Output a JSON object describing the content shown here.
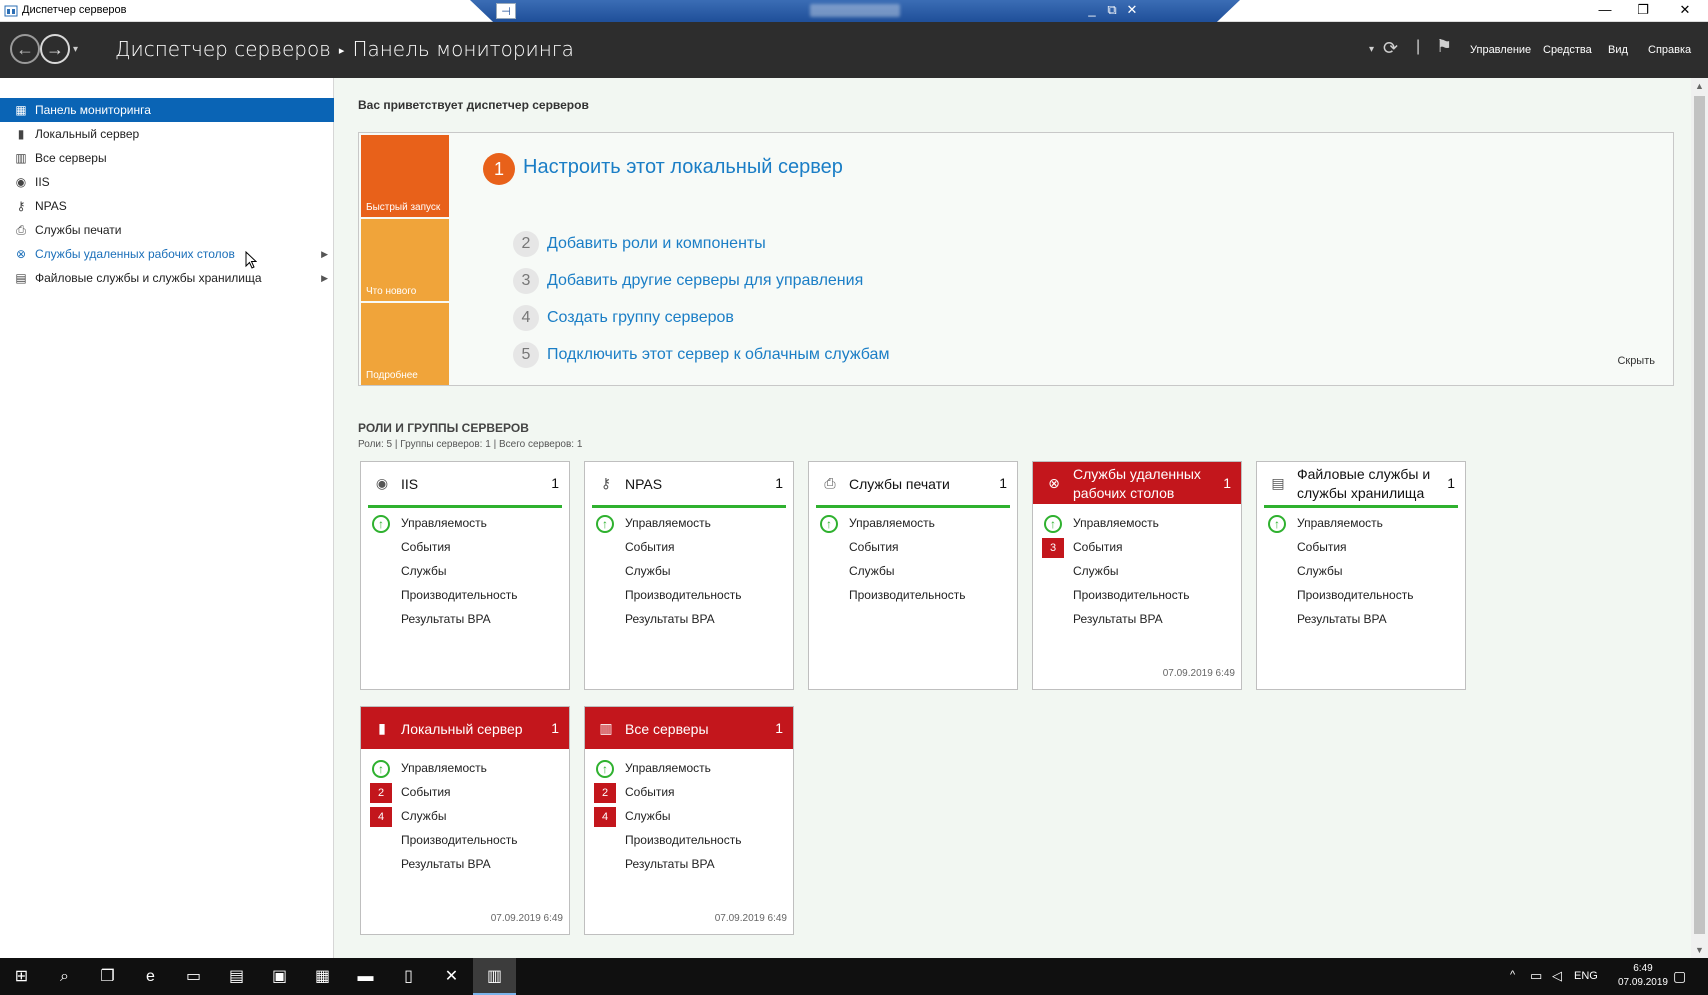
{
  "window": {
    "title": "Диспетчер серверов",
    "rdp_pin": "⊣",
    "rdp_controls": [
      "_",
      "⧉",
      "✕"
    ],
    "controls": [
      "—",
      "❐",
      "✕"
    ]
  },
  "header": {
    "breadcrumb_root": "Диспетчер серверов",
    "breadcrumb_sep": "▸",
    "breadcrumb_page": "Панель мониторинга",
    "menus": [
      "Управление",
      "Средства",
      "Вид",
      "Справка"
    ],
    "refresh_icon": "⟳",
    "flag_icon": "⚑",
    "drop_icon": "▾",
    "pipe": "|"
  },
  "sidebar": {
    "items": [
      {
        "label": "Панель мониторинга",
        "icon": "dashboard-icon",
        "glyph": "▦",
        "active": true
      },
      {
        "label": "Локальный сервер",
        "icon": "local-server-icon",
        "glyph": "▮"
      },
      {
        "label": "Все серверы",
        "icon": "all-servers-icon",
        "glyph": "▥"
      },
      {
        "label": "IIS",
        "icon": "iis-icon",
        "glyph": "◉"
      },
      {
        "label": "NPAS",
        "icon": "npas-icon",
        "glyph": "⚷"
      },
      {
        "label": "Службы печати",
        "icon": "printer-icon",
        "glyph": "⎙"
      },
      {
        "label": "Службы удаленных рабочих столов",
        "icon": "remote-desktop-icon",
        "glyph": "⊗",
        "link": true,
        "arrow": "▶"
      },
      {
        "label": "Файловые службы и службы хранилища",
        "icon": "file-services-icon",
        "glyph": "▤",
        "arrow": "▶"
      }
    ]
  },
  "main": {
    "welcome": "Вас приветствует диспетчер серверов",
    "quick_start": {
      "tabs": [
        {
          "label": "Быстрый запуск",
          "color": "#e8611a"
        },
        {
          "label": "Что нового",
          "color": "#f0a43a"
        },
        {
          "label": "Подробнее",
          "color": "#f0a43a"
        }
      ],
      "step1_num": "1",
      "step1": "Настроить этот локальный сервер",
      "steps": [
        {
          "num": "2",
          "label": "Добавить роли и компоненты"
        },
        {
          "num": "3",
          "label": "Добавить другие серверы для управления"
        },
        {
          "num": "4",
          "label": "Создать группу серверов"
        },
        {
          "num": "5",
          "label": "Подключить этот сервер к облачным службам"
        }
      ],
      "hide": "Скрыть"
    },
    "roles_title": "РОЛИ И ГРУППЫ СЕРВЕРОВ",
    "roles_subtitle": "Роли: 5 | Группы серверов: 1 | Всего серверов: 1",
    "tiles": [
      {
        "title": "IIS",
        "count": "1",
        "glyph": "◉",
        "icon": "iis-icon",
        "red": false,
        "rows": [
          {
            "label": "Управляемость",
            "status": "ok"
          },
          {
            "label": "События"
          },
          {
            "label": "Службы"
          },
          {
            "label": "Производительность"
          },
          {
            "label": "Результаты BPA"
          }
        ],
        "timestamp": ""
      },
      {
        "title": "NPAS",
        "count": "1",
        "glyph": "⚷",
        "icon": "npas-icon",
        "red": false,
        "rows": [
          {
            "label": "Управляемость",
            "status": "ok"
          },
          {
            "label": "События"
          },
          {
            "label": "Службы"
          },
          {
            "label": "Производительность"
          },
          {
            "label": "Результаты BPA"
          }
        ],
        "timestamp": ""
      },
      {
        "title": "Службы печати",
        "count": "1",
        "glyph": "⎙",
        "icon": "printer-icon",
        "red": false,
        "rows": [
          {
            "label": "Управляемость",
            "status": "ok"
          },
          {
            "label": "События"
          },
          {
            "label": "Службы"
          },
          {
            "label": "Производительность"
          }
        ],
        "timestamp": ""
      },
      {
        "title": "Службы удаленных рабочих столов",
        "count": "1",
        "glyph": "⊗",
        "icon": "remote-desktop-icon",
        "red": true,
        "rows": [
          {
            "label": "Управляемость",
            "status": "ok"
          },
          {
            "label": "События",
            "badge": "3"
          },
          {
            "label": "Службы"
          },
          {
            "label": "Производительность"
          },
          {
            "label": "Результаты BPA"
          }
        ],
        "timestamp": "07.09.2019 6:49"
      },
      {
        "title": "Файловые службы и службы хранилища",
        "count": "1",
        "glyph": "▤",
        "icon": "file-services-icon",
        "red": false,
        "rows": [
          {
            "label": "Управляемость",
            "status": "ok"
          },
          {
            "label": "События"
          },
          {
            "label": "Службы"
          },
          {
            "label": "Производительность"
          },
          {
            "label": "Результаты BPA"
          }
        ],
        "timestamp": ""
      },
      {
        "title": "Локальный сервер",
        "count": "1",
        "glyph": "▮",
        "icon": "local-server-icon",
        "red": true,
        "rows": [
          {
            "label": "Управляемость",
            "status": "ok"
          },
          {
            "label": "События",
            "badge": "2"
          },
          {
            "label": "Службы",
            "badge": "4"
          },
          {
            "label": "Производительность"
          },
          {
            "label": "Результаты BPA"
          }
        ],
        "timestamp": "07.09.2019 6:49"
      },
      {
        "title": "Все серверы",
        "count": "1",
        "glyph": "▥",
        "icon": "all-servers-icon",
        "red": true,
        "rows": [
          {
            "label": "Управляемость",
            "status": "ok"
          },
          {
            "label": "События",
            "badge": "2"
          },
          {
            "label": "Службы",
            "badge": "4"
          },
          {
            "label": "Производительность"
          },
          {
            "label": "Результаты BPA"
          }
        ],
        "timestamp": "07.09.2019 6:49"
      }
    ]
  },
  "taskbar": {
    "buttons": [
      {
        "icon": "windows-start-icon",
        "glyph": "⊞"
      },
      {
        "icon": "search-icon",
        "glyph": "⌕"
      },
      {
        "icon": "task-view-icon",
        "glyph": "❐"
      },
      {
        "icon": "internet-explorer-icon",
        "glyph": "e"
      },
      {
        "icon": "file-explorer-icon",
        "glyph": "▭"
      },
      {
        "icon": "task-manager-icon",
        "glyph": "▤"
      },
      {
        "icon": "network-icon",
        "glyph": "▣"
      },
      {
        "icon": "app-icon",
        "glyph": "▦"
      },
      {
        "icon": "terminal-icon",
        "glyph": "▬"
      },
      {
        "icon": "notepad-icon",
        "glyph": "▯"
      },
      {
        "icon": "tools-icon",
        "glyph": "✕"
      },
      {
        "icon": "server-manager-icon",
        "glyph": "▥",
        "active": true
      }
    ],
    "tray_chevron": "^",
    "tray_network": "▭",
    "tray_volume": "◁",
    "language": "ENG",
    "time": "6:49",
    "date": "07.09.2019",
    "notifications_glyph": "▢"
  }
}
